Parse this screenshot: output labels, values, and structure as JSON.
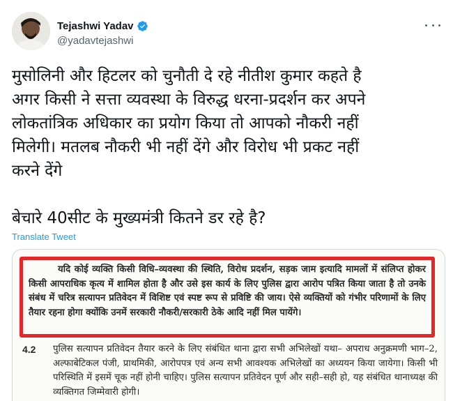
{
  "user": {
    "name": "Tejashwi Yadav",
    "handle": "@yadavtejashwi"
  },
  "icons": {
    "verified": "verified-badge-icon",
    "more": "more-options-icon"
  },
  "colors": {
    "link": "#1d9bf0",
    "verified": "#1d9bf0",
    "highlight_border": "#e8262a"
  },
  "tweet": {
    "lines": [
      "मुसोलिनी और हिटलर को चुनौती दे रहे नीतीश कुमार कहते है",
      "अगर किसी ने सत्ता व्यवस्था के विरुद्ध धरना-प्रदर्शन कर अपने",
      "लोकतांत्रिक अधिकार का प्रयोग किया तो आपको नौकरी नहीं",
      "मिलेगी। मतलब नौकरी भी नहीं देंगे और विरोध भी प्रकट नहीं",
      "करने देंगे"
    ],
    "second_paragraph": "बेचारे 40सीट के मुख्यमंत्री कितने डर रहे है?",
    "translate_label": "Translate Tweet"
  },
  "document": {
    "highlighted_text": "यदि कोई व्यक्ति किसी विधि–व्यवस्था की स्थिति, विरोध प्रदर्शन, सड़क जाम इत्यादि मामलों में संलिप्त होकर किसी आपराधिक कृत्य में शामिल होता है और उसे इस कार्य के लिए पुलिस द्वारा आरोप पत्रित किया जाता है तो उनके संबंध में चरित्र सत्यापन प्रतिवेदन में विशिष्ट एवं स्पष्ट रूप से प्रविष्टि की जाय। ऐसे व्यक्तियों को गंभीर परिणामों के लिए तैयार रहना होगा क्योंकि उनमें सरकारी नौकरी/सरकारी ठेके आदि नहीं मिल पायेंगे।",
    "section_number": "4.2",
    "section_text": "पुलिस सत्यापन प्रतिवेदन तैयार करने के लिए संबंधित थाना द्वारा सभी अभिलेखों यथा– अपराध अनुक्रमणी भाग–2, अल्फाबेटिकल पंजी, प्राथमिकी, आरोपपत्र एवं अन्य सभी आवश्यक अभिलेखों का अध्ययन किया जायेगा। किसी भी परिस्थिति में इसमें चूक नहीं होनी चाहिए। पुलिस सत्यापन प्रतिवेदन पूर्ण और सही–सही हो, यह संबंधित थानाध्यक्ष की व्यक्तिगत जिम्मेवारी होगी।"
  }
}
